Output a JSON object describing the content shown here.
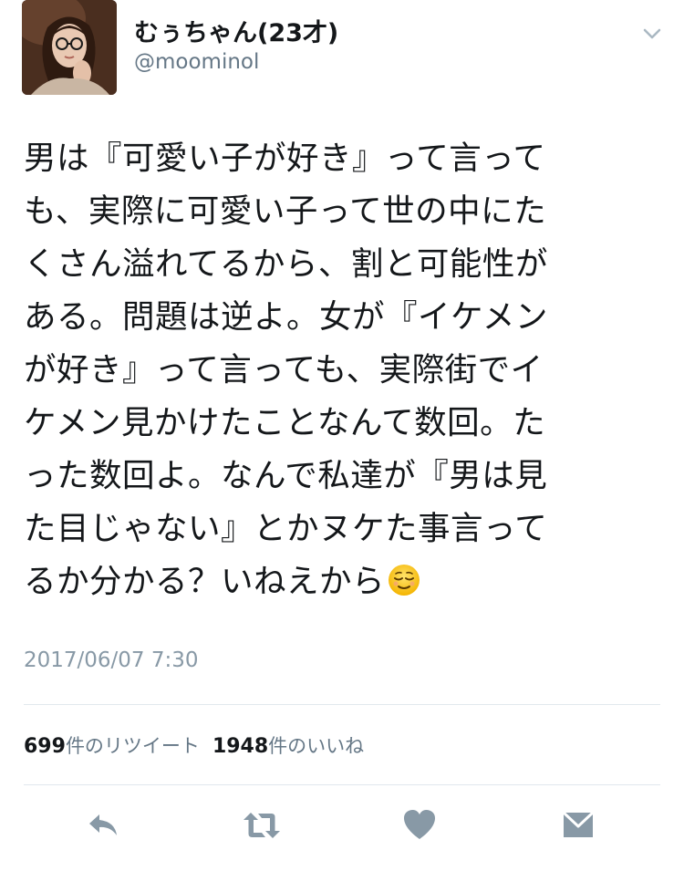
{
  "user": {
    "display_name": "むぅちゃん(23才)",
    "handle": "@moominol"
  },
  "tweet": {
    "lines": [
      "男は『可愛い子が好き』って言って",
      "も、実際に可愛い子って世の中にた",
      "くさん溢れてるから、割と可能性が",
      "ある。問題は逆よ。女が『イケメン",
      "が好き』って言っても、実際街でイ",
      "ケメン見かけたことなんて数回。た",
      "った数回よ。なんで私達が『男は見",
      "た目じゃない』とかヌケた事言って",
      "るか分かる？いねえから"
    ],
    "emoji": "relieved-face",
    "timestamp": "2017/06/07 7:30"
  },
  "stats": {
    "retweet_count": "699",
    "retweet_label": "件のリツイート",
    "like_count": "1948",
    "like_label": "件のいいね"
  },
  "icons": {
    "caret": "chevron-down-icon",
    "reply": "reply-icon",
    "retweet": "retweet-icon",
    "like": "heart-icon",
    "dm": "envelope-icon"
  },
  "colors": {
    "text": "#14171a",
    "secondary": "#657786",
    "timestamp": "#8899a6",
    "icon": "#8899a6",
    "divider": "#e1e8ed"
  }
}
